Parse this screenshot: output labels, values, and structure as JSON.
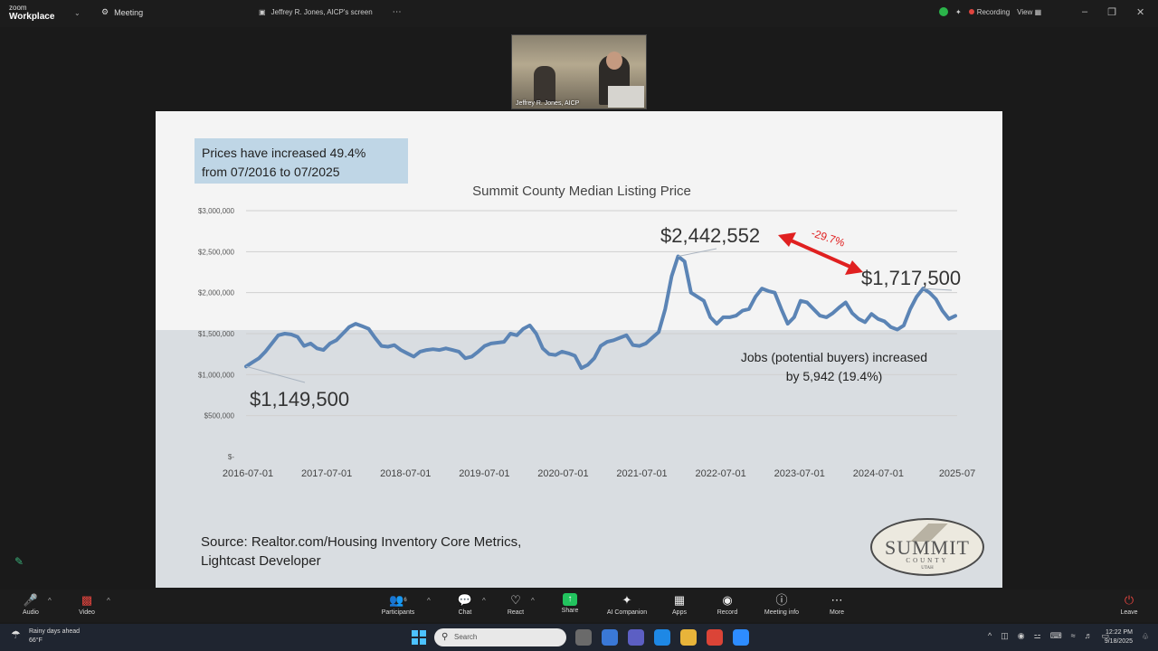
{
  "zoom": {
    "logo_line1": "zoom",
    "logo_line2": "Workplace",
    "meeting_tab": "Meeting",
    "screen_share_tab": "Jeffrey R. Jones, AICP's screen",
    "recording_label": "Recording",
    "view_label": "View",
    "participant_name": "Jeffrey R. Jones, AICP"
  },
  "slide": {
    "callout_line1": "Prices have increased 49.4%",
    "callout_line2": "from 07/2016 to 07/2025",
    "jobs_line1": "Jobs (potential buyers) increased",
    "jobs_line2": "by 5,942 (19.4%)",
    "source_line1": "Source: Realtor.com/Housing Inventory Core Metrics,",
    "source_line2": "Lightcast Developer",
    "logo_word": "SUMMIT",
    "logo_sub": "COUNTY",
    "logo_state": "UTAH"
  },
  "chart_data": {
    "type": "line",
    "title": "Summit County Median Listing Price",
    "y_ticks": [
      "$3,000,000",
      "$2,500,000",
      "$2,000,000",
      "$1,500,000",
      "$1,000,000",
      "$500,000",
      "$-"
    ],
    "ylim": [
      0,
      3000000
    ],
    "x_ticks": [
      "2016-07-01",
      "2017-07-01",
      "2018-07-01",
      "2019-07-01",
      "2020-07-01",
      "2021-07-01",
      "2022-07-01",
      "2023-07-01",
      "2024-07-01",
      "2025-07"
    ],
    "series": [
      {
        "color": "#5b84b5",
        "values": [
          1100000,
          1150000,
          1200000,
          1280000,
          1380000,
          1480000,
          1500000,
          1490000,
          1460000,
          1350000,
          1380000,
          1320000,
          1300000,
          1380000,
          1420000,
          1500000,
          1580000,
          1620000,
          1590000,
          1560000,
          1450000,
          1350000,
          1340000,
          1360000,
          1300000,
          1260000,
          1220000,
          1280000,
          1300000,
          1310000,
          1300000,
          1320000,
          1300000,
          1280000,
          1200000,
          1220000,
          1280000,
          1350000,
          1380000,
          1390000,
          1400000,
          1500000,
          1480000,
          1560000,
          1600000,
          1500000,
          1320000,
          1250000,
          1240000,
          1280000,
          1260000,
          1230000,
          1080000,
          1120000,
          1200000,
          1350000,
          1400000,
          1420000,
          1450000,
          1480000,
          1360000,
          1350000,
          1380000,
          1450000,
          1520000,
          1800000,
          2200000,
          2442552,
          2380000,
          2000000,
          1950000,
          1900000,
          1700000,
          1620000,
          1700000,
          1700000,
          1720000,
          1780000,
          1800000,
          1950000,
          2050000,
          2020000,
          2000000,
          1800000,
          1620000,
          1700000,
          1900000,
          1880000,
          1800000,
          1720000,
          1700000,
          1750000,
          1820000,
          1880000,
          1750000,
          1680000,
          1640000,
          1740000,
          1680000,
          1650000,
          1580000,
          1550000,
          1600000,
          1800000,
          1950000,
          2050000,
          2000000,
          1920000,
          1780000,
          1680000,
          1717500
        ]
      }
    ],
    "annotations": {
      "start": "$1,149,500",
      "peak": "$2,442,552",
      "latest": "$1,717,500",
      "change": "-29.7%"
    }
  },
  "toolbar": {
    "audio": "Audio",
    "video": "Video",
    "participants": "Participants",
    "participants_count": "6",
    "chat": "Chat",
    "react": "React",
    "share": "Share",
    "ai_companion": "AI Companion",
    "apps": "Apps",
    "record": "Record",
    "meeting_info": "Meeting info",
    "more": "More",
    "leave": "Leave"
  },
  "taskbar": {
    "weather_line1": "Rainy days ahead",
    "weather_line2": "66°F",
    "search_placeholder": "Search",
    "time": "12:22 PM",
    "date": "9/18/2025"
  }
}
